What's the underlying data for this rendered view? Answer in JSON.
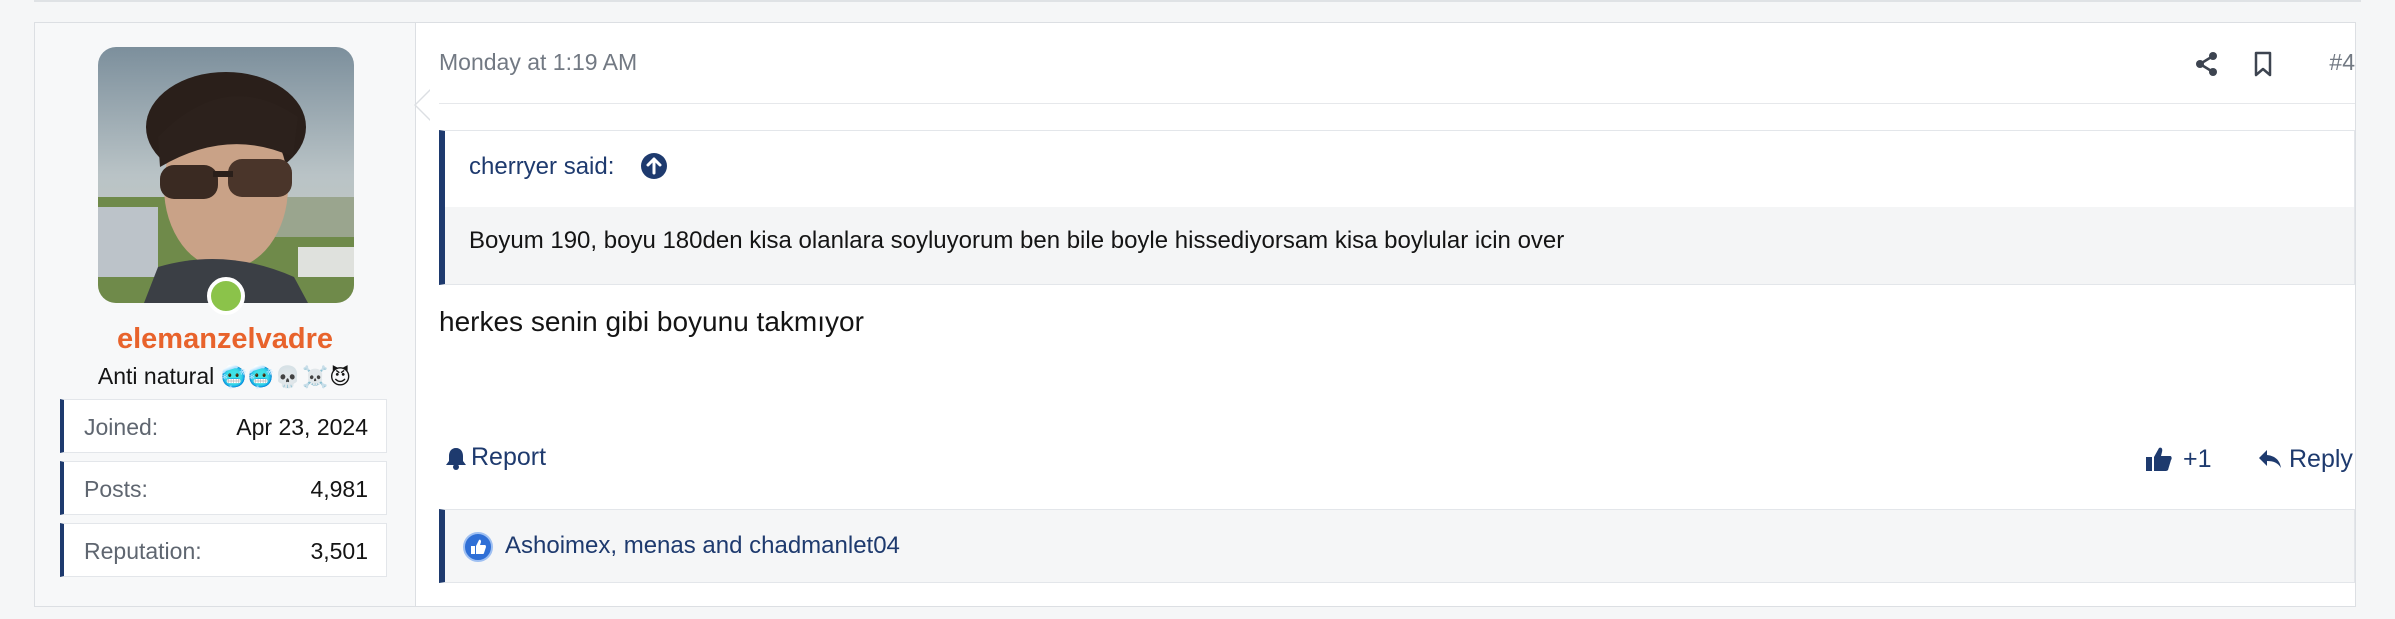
{
  "post": {
    "date": "Monday at 1:19 AM",
    "number": "#4",
    "user": {
      "username": "elemanzelvadre",
      "title_text": "Anti natural",
      "title_emojis": "🥶🥶💀☠️😈",
      "stats": [
        {
          "label": "Joined:",
          "value": "Apr 23, 2024"
        },
        {
          "label": "Posts:",
          "value": "4,981"
        },
        {
          "label": "Reputation:",
          "value": "3,501"
        }
      ]
    },
    "quote": {
      "author": "cherryer said:",
      "text": "Boyum 190, boyu 180den kisa olanlara soyluyorum ben bile boyle hissediyorsam kisa boylular icin over"
    },
    "message": "herkes senin gibi boyunu takmıyor",
    "actions": {
      "report": "Report",
      "like_count": "+1",
      "reply": "Reply"
    },
    "likes_text": "Ashoimex, menas and chadmanlet04"
  },
  "colors": {
    "accent": "#1e3a6e",
    "username": "#e8632c",
    "online": "#8bc34a"
  },
  "icons": [
    "share-icon",
    "bookmark-icon",
    "up-arrow-icon",
    "bell-icon",
    "thumbs-up-icon",
    "reply-icon",
    "like-reaction-icon"
  ]
}
